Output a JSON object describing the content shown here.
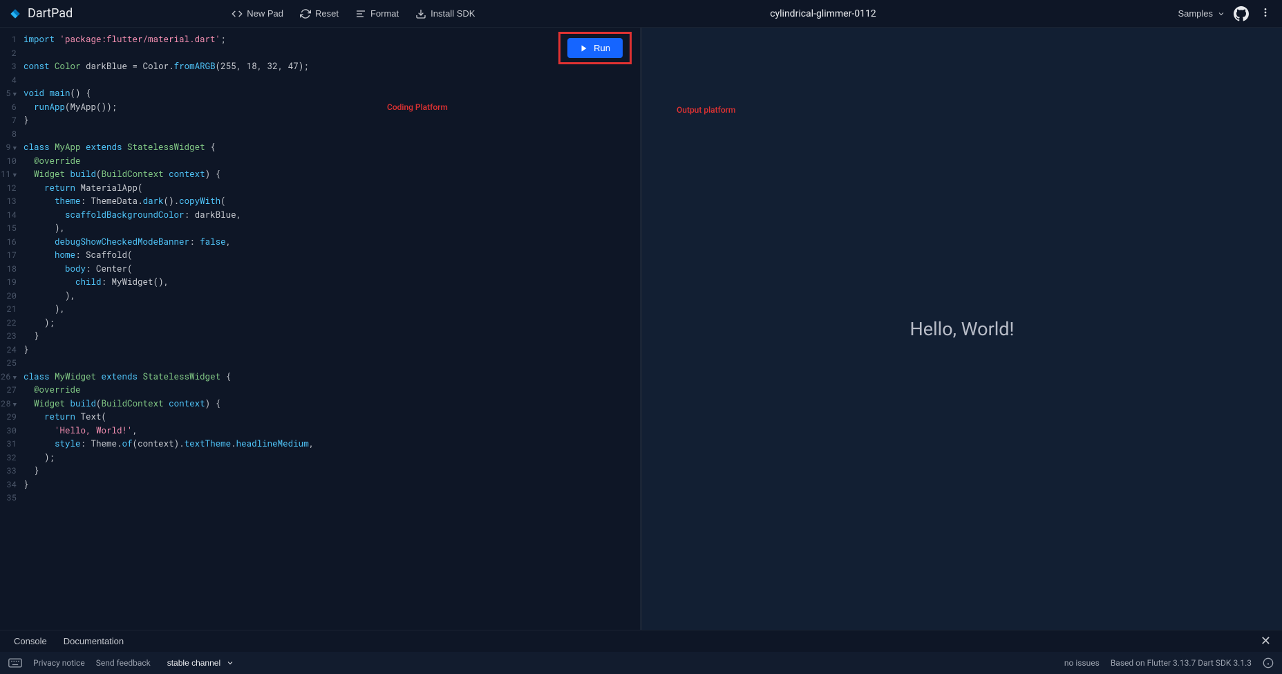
{
  "header": {
    "app_name": "DartPad",
    "new_pad": "New Pad",
    "reset": "Reset",
    "format": "Format",
    "install_sdk": "Install SDK",
    "project_name": "cylindrical-glimmer-0112",
    "samples": "Samples"
  },
  "editor": {
    "gutter": [
      {
        "n": "1"
      },
      {
        "n": "2"
      },
      {
        "n": "3"
      },
      {
        "n": "4"
      },
      {
        "n": "5",
        "fold": true
      },
      {
        "n": "6"
      },
      {
        "n": "7"
      },
      {
        "n": "8"
      },
      {
        "n": "9",
        "fold": true
      },
      {
        "n": "10"
      },
      {
        "n": "11",
        "fold": true
      },
      {
        "n": "12"
      },
      {
        "n": "13"
      },
      {
        "n": "14"
      },
      {
        "n": "15"
      },
      {
        "n": "16"
      },
      {
        "n": "17"
      },
      {
        "n": "18"
      },
      {
        "n": "19"
      },
      {
        "n": "20"
      },
      {
        "n": "21"
      },
      {
        "n": "22"
      },
      {
        "n": "23"
      },
      {
        "n": "24"
      },
      {
        "n": "25"
      },
      {
        "n": "26",
        "fold": true
      },
      {
        "n": "27"
      },
      {
        "n": "28",
        "fold": true
      },
      {
        "n": "29"
      },
      {
        "n": "30"
      },
      {
        "n": "31"
      },
      {
        "n": "32"
      },
      {
        "n": "33"
      },
      {
        "n": "34"
      },
      {
        "n": "35"
      }
    ],
    "code_lines": [
      [
        {
          "t": "import ",
          "c": "s-keyword"
        },
        {
          "t": "'package:flutter/material.dart'",
          "c": "s-string"
        },
        {
          "t": ";",
          "c": "s-punc"
        }
      ],
      [],
      [
        {
          "t": "const ",
          "c": "s-keyword"
        },
        {
          "t": "Color ",
          "c": "s-type"
        },
        {
          "t": "darkBlue",
          "c": "s-var"
        },
        {
          "t": " = ",
          "c": "s-punc"
        },
        {
          "t": "Color",
          "c": "s-var"
        },
        {
          "t": ".",
          "c": "s-punc"
        },
        {
          "t": "fromARGB",
          "c": "s-method"
        },
        {
          "t": "(",
          "c": "s-punc"
        },
        {
          "t": "255",
          "c": "s-number"
        },
        {
          "t": ", ",
          "c": "s-punc"
        },
        {
          "t": "18",
          "c": "s-number"
        },
        {
          "t": ", ",
          "c": "s-punc"
        },
        {
          "t": "32",
          "c": "s-number"
        },
        {
          "t": ", ",
          "c": "s-punc"
        },
        {
          "t": "47",
          "c": "s-number"
        },
        {
          "t": ");",
          "c": "s-punc"
        }
      ],
      [],
      [
        {
          "t": "void ",
          "c": "s-keyword"
        },
        {
          "t": "main",
          "c": "s-method"
        },
        {
          "t": "() {",
          "c": "s-punc"
        }
      ],
      [
        {
          "t": "  ",
          "c": ""
        },
        {
          "t": "runApp",
          "c": "s-method"
        },
        {
          "t": "(",
          "c": "s-punc"
        },
        {
          "t": "MyApp",
          "c": "s-var"
        },
        {
          "t": "());",
          "c": "s-punc"
        }
      ],
      [
        {
          "t": "}",
          "c": "s-punc"
        }
      ],
      [],
      [
        {
          "t": "class ",
          "c": "s-keyword"
        },
        {
          "t": "MyApp ",
          "c": "s-type"
        },
        {
          "t": "extends ",
          "c": "s-keyword"
        },
        {
          "t": "StatelessWidget ",
          "c": "s-type"
        },
        {
          "t": "{",
          "c": "s-punc"
        }
      ],
      [
        {
          "t": "  ",
          "c": ""
        },
        {
          "t": "@override",
          "c": "s-anno"
        }
      ],
      [
        {
          "t": "  ",
          "c": ""
        },
        {
          "t": "Widget ",
          "c": "s-type"
        },
        {
          "t": "build",
          "c": "s-method"
        },
        {
          "t": "(",
          "c": "s-punc"
        },
        {
          "t": "BuildContext ",
          "c": "s-type"
        },
        {
          "t": "context",
          "c": "s-prop"
        },
        {
          "t": ") {",
          "c": "s-punc"
        }
      ],
      [
        {
          "t": "    ",
          "c": ""
        },
        {
          "t": "return ",
          "c": "s-ret"
        },
        {
          "t": "MaterialApp",
          "c": "s-var"
        },
        {
          "t": "(",
          "c": "s-punc"
        }
      ],
      [
        {
          "t": "      ",
          "c": ""
        },
        {
          "t": "theme",
          "c": "s-prop"
        },
        {
          "t": ": ",
          "c": "s-punc"
        },
        {
          "t": "ThemeData",
          "c": "s-var"
        },
        {
          "t": ".",
          "c": "s-punc"
        },
        {
          "t": "dark",
          "c": "s-method"
        },
        {
          "t": "().",
          "c": "s-punc"
        },
        {
          "t": "copyWith",
          "c": "s-method"
        },
        {
          "t": "(",
          "c": "s-punc"
        }
      ],
      [
        {
          "t": "        ",
          "c": ""
        },
        {
          "t": "scaffoldBackgroundColor",
          "c": "s-prop"
        },
        {
          "t": ": ",
          "c": "s-punc"
        },
        {
          "t": "darkBlue",
          "c": "s-var"
        },
        {
          "t": ",",
          "c": "s-punc"
        }
      ],
      [
        {
          "t": "      ),",
          "c": "s-punc"
        }
      ],
      [
        {
          "t": "      ",
          "c": ""
        },
        {
          "t": "debugShowCheckedModeBanner",
          "c": "s-prop"
        },
        {
          "t": ": ",
          "c": "s-punc"
        },
        {
          "t": "false",
          "c": "s-false"
        },
        {
          "t": ",",
          "c": "s-punc"
        }
      ],
      [
        {
          "t": "      ",
          "c": ""
        },
        {
          "t": "home",
          "c": "s-prop"
        },
        {
          "t": ": ",
          "c": "s-punc"
        },
        {
          "t": "Scaffold",
          "c": "s-var"
        },
        {
          "t": "(",
          "c": "s-punc"
        }
      ],
      [
        {
          "t": "        ",
          "c": ""
        },
        {
          "t": "body",
          "c": "s-prop"
        },
        {
          "t": ": ",
          "c": "s-punc"
        },
        {
          "t": "Center",
          "c": "s-var"
        },
        {
          "t": "(",
          "c": "s-punc"
        }
      ],
      [
        {
          "t": "          ",
          "c": ""
        },
        {
          "t": "child",
          "c": "s-prop"
        },
        {
          "t": ": ",
          "c": "s-punc"
        },
        {
          "t": "MyWidget",
          "c": "s-var"
        },
        {
          "t": "(),",
          "c": "s-punc"
        }
      ],
      [
        {
          "t": "        ),",
          "c": "s-punc"
        }
      ],
      [
        {
          "t": "      ),",
          "c": "s-punc"
        }
      ],
      [
        {
          "t": "    );",
          "c": "s-punc"
        }
      ],
      [
        {
          "t": "  }",
          "c": "s-punc"
        }
      ],
      [
        {
          "t": "}",
          "c": "s-punc"
        }
      ],
      [],
      [
        {
          "t": "class ",
          "c": "s-keyword"
        },
        {
          "t": "MyWidget ",
          "c": "s-type"
        },
        {
          "t": "extends ",
          "c": "s-keyword"
        },
        {
          "t": "StatelessWidget ",
          "c": "s-type"
        },
        {
          "t": "{",
          "c": "s-punc"
        }
      ],
      [
        {
          "t": "  ",
          "c": ""
        },
        {
          "t": "@override",
          "c": "s-anno"
        }
      ],
      [
        {
          "t": "  ",
          "c": ""
        },
        {
          "t": "Widget ",
          "c": "s-type"
        },
        {
          "t": "build",
          "c": "s-method"
        },
        {
          "t": "(",
          "c": "s-punc"
        },
        {
          "t": "BuildContext ",
          "c": "s-type"
        },
        {
          "t": "context",
          "c": "s-prop"
        },
        {
          "t": ") {",
          "c": "s-punc"
        }
      ],
      [
        {
          "t": "    ",
          "c": ""
        },
        {
          "t": "return ",
          "c": "s-ret"
        },
        {
          "t": "Text",
          "c": "s-var"
        },
        {
          "t": "(",
          "c": "s-punc"
        }
      ],
      [
        {
          "t": "      ",
          "c": ""
        },
        {
          "t": "'Hello, World!'",
          "c": "s-string"
        },
        {
          "t": ",",
          "c": "s-punc"
        }
      ],
      [
        {
          "t": "      ",
          "c": ""
        },
        {
          "t": "style",
          "c": "s-prop"
        },
        {
          "t": ": ",
          "c": "s-punc"
        },
        {
          "t": "Theme",
          "c": "s-var"
        },
        {
          "t": ".",
          "c": "s-punc"
        },
        {
          "t": "of",
          "c": "s-method"
        },
        {
          "t": "(",
          "c": "s-punc"
        },
        {
          "t": "context",
          "c": "s-var"
        },
        {
          "t": ").",
          "c": "s-punc"
        },
        {
          "t": "textTheme",
          "c": "s-prop"
        },
        {
          "t": ".",
          "c": "s-punc"
        },
        {
          "t": "headlineMedium",
          "c": "s-prop"
        },
        {
          "t": ",",
          "c": "s-punc"
        }
      ],
      [
        {
          "t": "    );",
          "c": "s-punc"
        }
      ],
      [
        {
          "t": "  }",
          "c": "s-punc"
        }
      ],
      [
        {
          "t": "}",
          "c": "s-punc"
        }
      ],
      []
    ],
    "run_label": "Run"
  },
  "annotations": {
    "coding": "Coding Platform",
    "output": "Output platform"
  },
  "output": {
    "text": "Hello, World!"
  },
  "tabs": {
    "console": "Console",
    "documentation": "Documentation"
  },
  "footer": {
    "privacy": "Privacy notice",
    "feedback": "Send feedback",
    "channel": "stable channel",
    "issues": "no issues",
    "version": "Based on Flutter 3.13.7 Dart SDK 3.1.3"
  }
}
